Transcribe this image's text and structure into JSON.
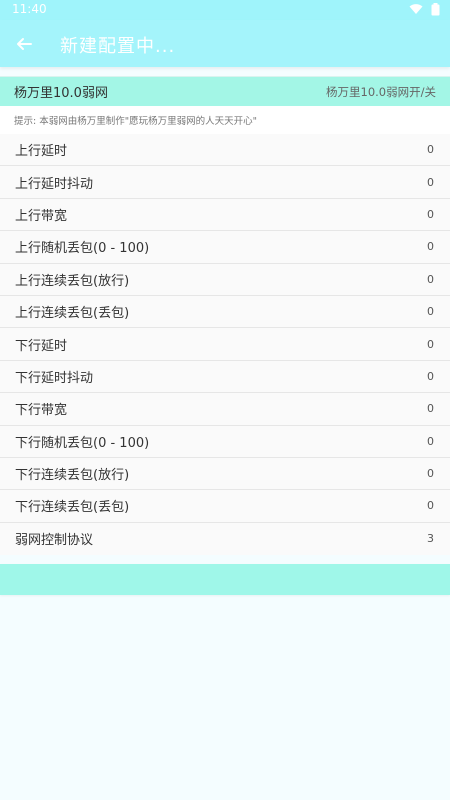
{
  "statusbar": {
    "time": "11:40",
    "wifi_icon": "wifi-icon",
    "battery_icon": "battery-icon"
  },
  "appbar": {
    "back_icon": "arrow-left-icon",
    "title": "新建配置中..."
  },
  "header": {
    "name": "杨万里10.0弱网",
    "toggle_label": "杨万里10.0弱网开/关"
  },
  "tip": "提示: 本弱网由杨万里制作\"愿玩杨万里弱网的人天天开心\"",
  "settings": [
    {
      "label": "上行延时",
      "value": "0"
    },
    {
      "label": "上行延时抖动",
      "value": "0"
    },
    {
      "label": "上行带宽",
      "value": "0"
    },
    {
      "label": "上行随机丢包(0 - 100)",
      "value": "0"
    },
    {
      "label": "上行连续丢包(放行)",
      "value": "0"
    },
    {
      "label": "上行连续丢包(丢包)",
      "value": "0"
    },
    {
      "label": "下行延时",
      "value": "0"
    },
    {
      "label": "下行延时抖动",
      "value": "0"
    },
    {
      "label": "下行带宽",
      "value": "0"
    },
    {
      "label": "下行随机丢包(0 - 100)",
      "value": "0"
    },
    {
      "label": "下行连续丢包(放行)",
      "value": "0"
    },
    {
      "label": "下行连续丢包(丢包)",
      "value": "0"
    },
    {
      "label": "弱网控制协议",
      "value": "3"
    }
  ],
  "start_button": {
    "label": ""
  },
  "colors": {
    "appbar": "#a4f4fb",
    "header": "#a3f6e6",
    "background": "#f4fdff",
    "button": "#9ff7e9"
  }
}
